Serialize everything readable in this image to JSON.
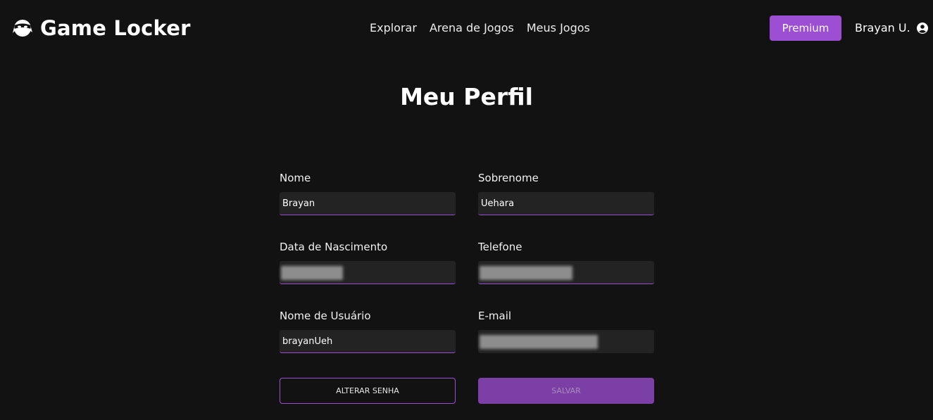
{
  "brand": {
    "name": "Game Locker",
    "icon": "ninja-mask-icon"
  },
  "nav": {
    "items": [
      {
        "label": "Explorar"
      },
      {
        "label": "Arena de Jogos"
      },
      {
        "label": "Meus Jogos"
      }
    ]
  },
  "header": {
    "premium_label": "Premium",
    "user_name": "Brayan U.",
    "user_icon": "user-circle-icon"
  },
  "page": {
    "title": "Meu Perfil"
  },
  "form": {
    "nome": {
      "label": "Nome",
      "value": "Brayan"
    },
    "sobrenome": {
      "label": "Sobrenome",
      "value": "Uehara"
    },
    "nascimento": {
      "label": "Data de Nascimento",
      "value": ""
    },
    "telefone": {
      "label": "Telefone",
      "value": ""
    },
    "usuario": {
      "label": "Nome de Usuário",
      "value": "brayanUeh"
    },
    "email": {
      "label": "E-mail",
      "value": ""
    }
  },
  "actions": {
    "change_password_label": "ALTERAR SENHA",
    "save_label": "SALVAR"
  },
  "colors": {
    "background": "#121212",
    "accent": "#9c4fd2",
    "save_button": "#7b3fa6",
    "input_background": "#232323"
  }
}
